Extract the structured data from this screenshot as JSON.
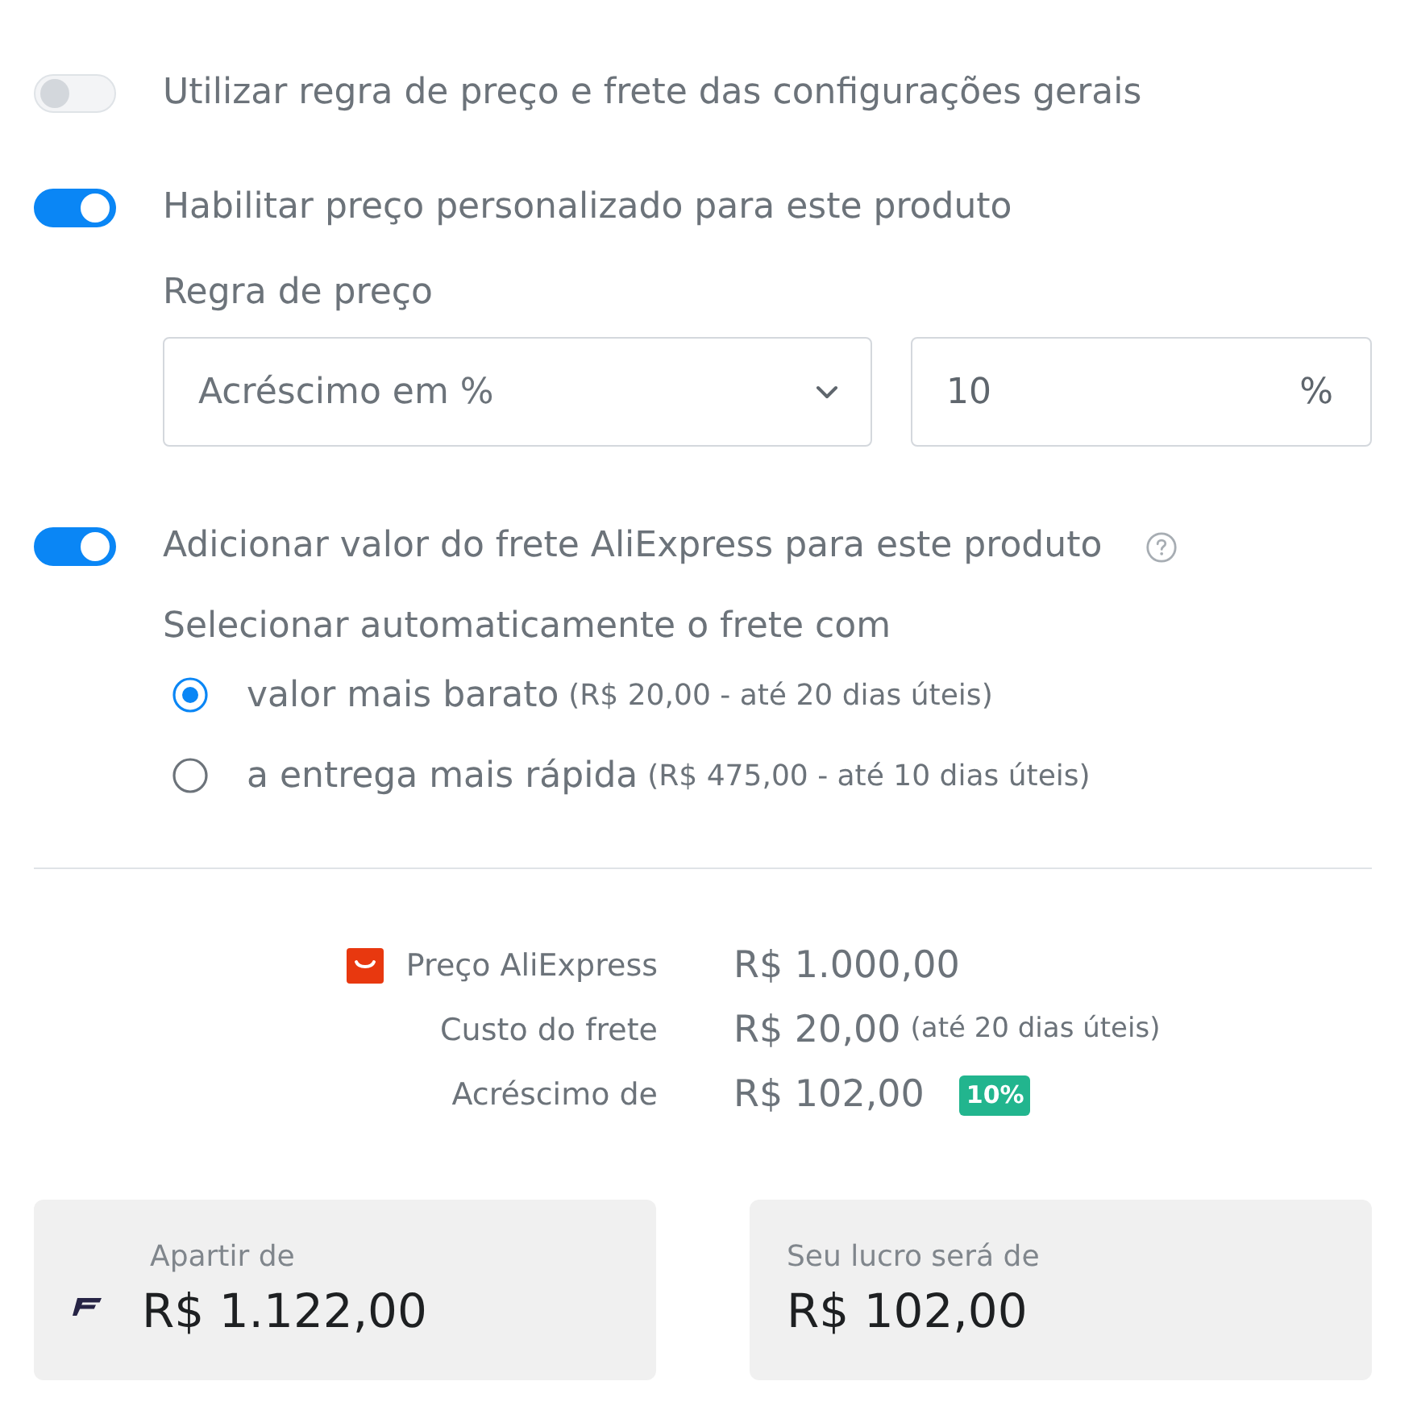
{
  "general_rule": {
    "label": "Utilizar regra de preço e frete das configurações gerais",
    "on": false
  },
  "custom_price": {
    "label": "Habilitar preço personalizado para este produto",
    "on": true,
    "rule_label": "Regra de preço",
    "rule_select": {
      "value": "Acréscimo em %"
    },
    "amount": {
      "value": "10",
      "suffix": "%"
    }
  },
  "shipping": {
    "label": "Adicionar valor do frete AliExpress para este produto",
    "on": true,
    "subtitle": "Selecionar automaticamente o frete com",
    "options": [
      {
        "label": "valor mais barato",
        "detail": "(R$ 20,00 - até 20 dias úteis)",
        "selected": true
      },
      {
        "label": "a entrega mais rápida",
        "detail": "(R$ 475,00 - até 10 dias úteis)",
        "selected": false
      }
    ]
  },
  "summary": {
    "rows": [
      {
        "label": "Preço AliExpress",
        "value": "R$ 1.000,00"
      },
      {
        "label": "Custo do frete",
        "value": "R$ 20,00",
        "note": "(até 20 dias úteis)"
      },
      {
        "label": "Acréscimo de",
        "value": "R$ 102,00",
        "badge": "10%"
      }
    ]
  },
  "cards": [
    {
      "label": "Apartir de",
      "value": "R$ 1.122,00"
    },
    {
      "label": "Seu lucro será de",
      "value": "R$ 102,00"
    }
  ]
}
